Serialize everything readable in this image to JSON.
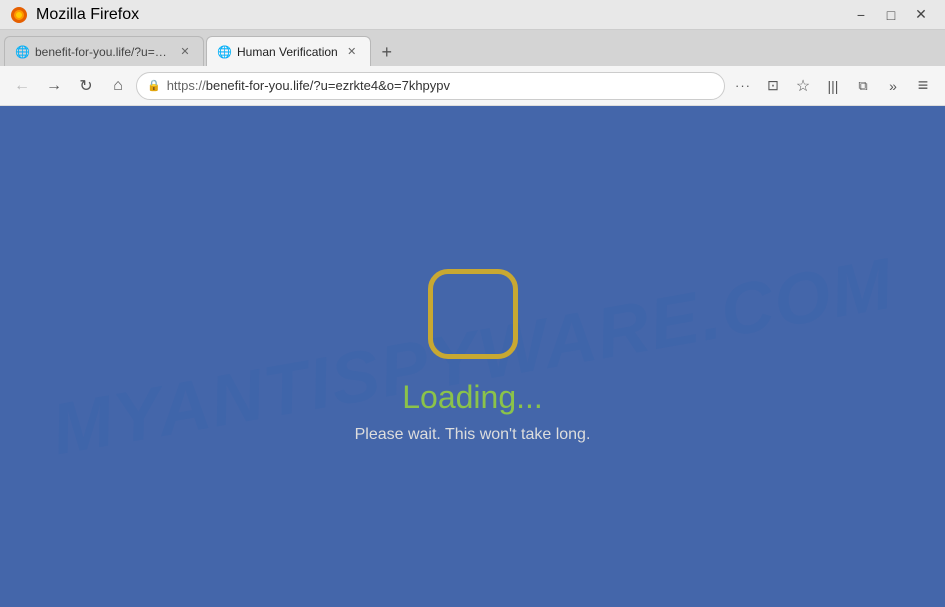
{
  "titlebar": {
    "title": "Mozilla Firefox",
    "minimize_label": "−",
    "maximize_label": "□",
    "close_label": "✕"
  },
  "tabs": {
    "tab1": {
      "label": "benefit-for-you.life/?u=e...",
      "favicon": "🌐"
    },
    "tab2": {
      "label": "Human Verification",
      "favicon": "🌐",
      "active": true
    },
    "new_tab_label": "+"
  },
  "navbar": {
    "back_icon": "←",
    "forward_icon": "→",
    "reload_icon": "↻",
    "home_icon": "⌂",
    "url": "https://benefit-for-you.life/?u=ezrkte4&o=7khpypv",
    "url_scheme": "https://",
    "url_host": "benefit-for-you.life",
    "url_path": "/?u=ezrkte4&o=7khpypv",
    "lock_icon": "🔒",
    "menu_icon": "≡",
    "more_icon": "···",
    "bookmarks_icon": "☆",
    "library_icon": "📚",
    "sidebar_icon": "⧉",
    "overflow_icon": "»"
  },
  "page": {
    "watermark": "MYANTISPYWARE.COM",
    "loading_text": "Loading...",
    "subtext": "Please wait. This won't take long.",
    "background_color": "#4a6fb5"
  }
}
